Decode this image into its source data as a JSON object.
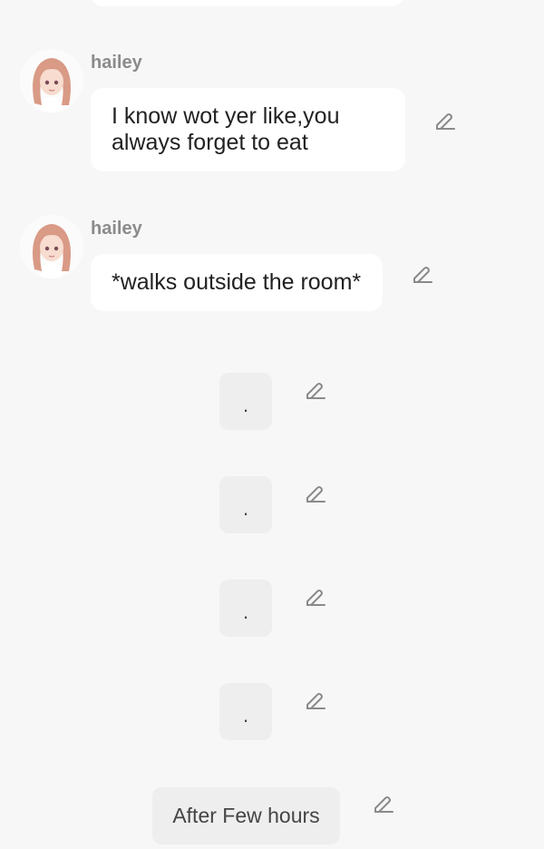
{
  "messages": [
    {
      "sender": "hailey",
      "text": "I know wot yer like,you always forget to eat"
    },
    {
      "sender": "hailey",
      "text": "*walks outside the room*"
    }
  ],
  "narration": [
    {
      "text": "."
    },
    {
      "text": "."
    },
    {
      "text": "."
    },
    {
      "text": "."
    },
    {
      "text": "After Few hours"
    }
  ],
  "icons": {
    "edit": "pencil-edit-icon",
    "avatar": "anime-girl-avatar"
  },
  "colors": {
    "background": "#f7f7f7",
    "bubble": "#ffffff",
    "narration_bubble": "#eeeeee",
    "sender": "#8b8b8b",
    "icon": "#8a8a8a"
  }
}
